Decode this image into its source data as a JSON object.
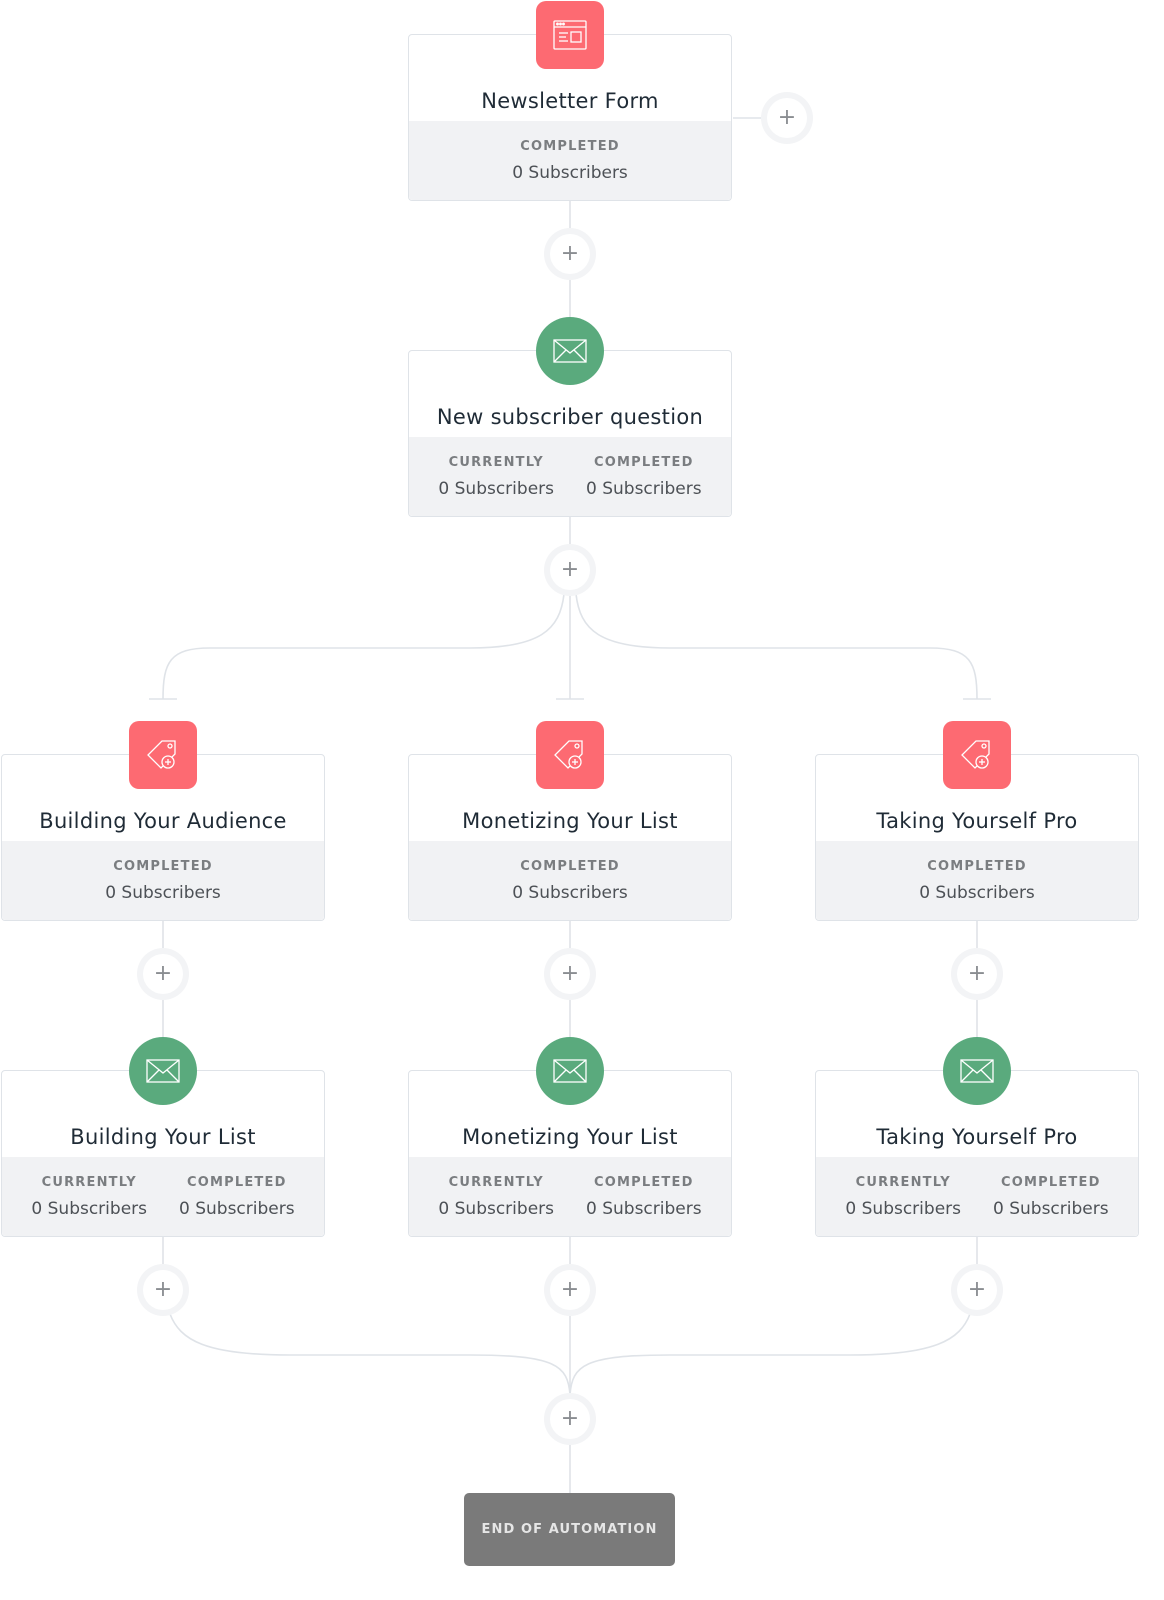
{
  "colors": {
    "form_icon_bg": "#fd6a72",
    "tag_icon_bg": "#fd6a72",
    "email_icon_bg": "#5aaa7d",
    "end_bg": "#7a7a7a",
    "connector": "#dfe3e8"
  },
  "nodes": {
    "newsletter_form": {
      "icon": "form-icon",
      "title": "Newsletter Form",
      "stats": [
        {
          "label": "COMPLETED",
          "value": "0 Subscribers"
        }
      ]
    },
    "new_subscriber_question": {
      "icon": "envelope-icon",
      "title": "New subscriber question",
      "stats": [
        {
          "label": "CURRENTLY",
          "value": "0 Subscribers"
        },
        {
          "label": "COMPLETED",
          "value": "0 Subscribers"
        }
      ]
    },
    "tag_building_audience": {
      "icon": "tag-add-icon",
      "title": "Building Your Audience",
      "stats": [
        {
          "label": "COMPLETED",
          "value": "0 Subscribers"
        }
      ]
    },
    "tag_monetizing_list": {
      "icon": "tag-add-icon",
      "title": "Monetizing Your List",
      "stats": [
        {
          "label": "COMPLETED",
          "value": "0 Subscribers"
        }
      ]
    },
    "tag_taking_pro": {
      "icon": "tag-add-icon",
      "title": "Taking Yourself Pro",
      "stats": [
        {
          "label": "COMPLETED",
          "value": "0 Subscribers"
        }
      ]
    },
    "email_building_list": {
      "icon": "envelope-icon",
      "title": "Building Your List",
      "stats": [
        {
          "label": "CURRENTLY",
          "value": "0 Subscribers"
        },
        {
          "label": "COMPLETED",
          "value": "0 Subscribers"
        }
      ]
    },
    "email_monetizing_list": {
      "icon": "envelope-icon",
      "title": "Monetizing Your List",
      "stats": [
        {
          "label": "CURRENTLY",
          "value": "0 Subscribers"
        },
        {
          "label": "COMPLETED",
          "value": "0 Subscribers"
        }
      ]
    },
    "email_taking_pro": {
      "icon": "envelope-icon",
      "title": "Taking Yourself Pro",
      "stats": [
        {
          "label": "CURRENTLY",
          "value": "0 Subscribers"
        },
        {
          "label": "COMPLETED",
          "value": "0 Subscribers"
        }
      ]
    }
  },
  "add_step_symbol": "+",
  "end": {
    "label": "END OF AUTOMATION"
  }
}
